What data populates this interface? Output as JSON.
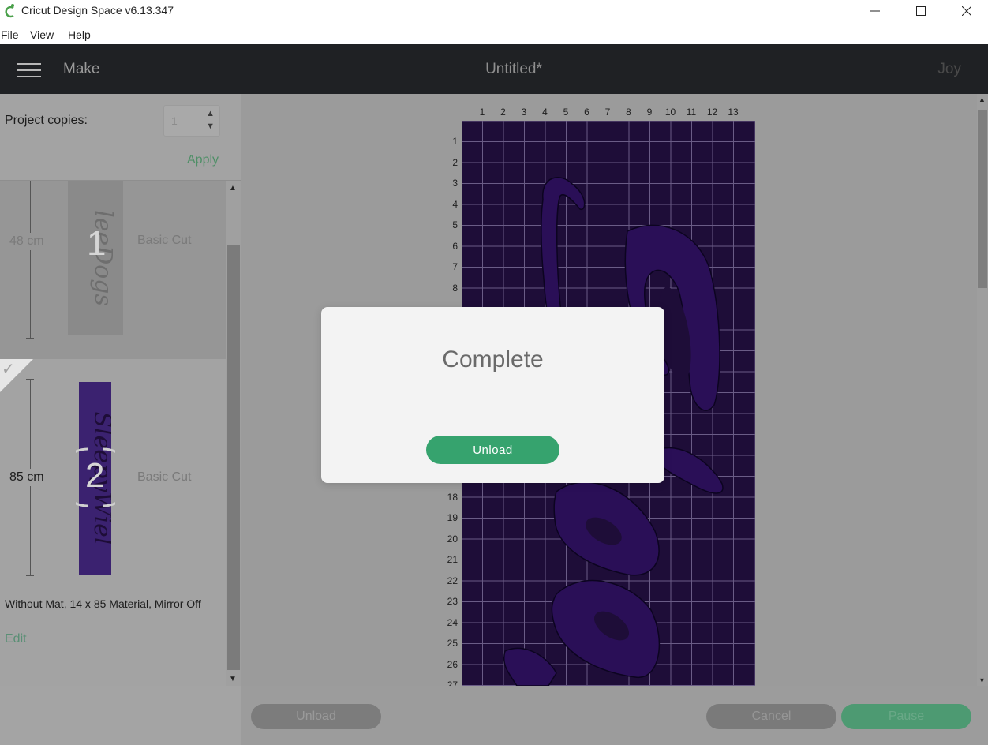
{
  "window": {
    "title": "Cricut Design Space  v6.13.347",
    "minimize": "—",
    "maximize": "☐",
    "close": "✕"
  },
  "menu": {
    "items": [
      "File",
      "View",
      "Help"
    ]
  },
  "header": {
    "section": "Make",
    "document_title": "Untitled*",
    "user": "Joy"
  },
  "copies": {
    "label": "Project copies:",
    "value": "1",
    "apply_label": "Apply"
  },
  "mats": [
    {
      "number": "1",
      "length": "48 cm",
      "type": "Basic Cut",
      "selected": false
    },
    {
      "number": "2",
      "length": "85 cm",
      "type": "Basic Cut",
      "selected": true
    }
  ],
  "mat_settings": {
    "description": "Without Mat, 14 x 85 Material, Mirror Off",
    "edit_label": "Edit"
  },
  "ruler": {
    "columns": [
      "1",
      "2",
      "3",
      "4",
      "5",
      "6",
      "7",
      "8",
      "9",
      "10",
      "11",
      "12",
      "13"
    ],
    "rows": [
      "1",
      "2",
      "3",
      "4",
      "5",
      "6",
      "7",
      "8",
      "",
      "",
      "",
      "",
      "",
      "",
      "",
      "",
      "",
      "18",
      "19",
      "20",
      "21",
      "22",
      "23",
      "24",
      "25",
      "26",
      "27"
    ]
  },
  "footer": {
    "unload_label": "Unload",
    "cancel_label": "Cancel",
    "pause_label": "Pause"
  },
  "modal": {
    "title": "Complete",
    "button_label": "Unload"
  },
  "colors": {
    "accent": "#36a36e",
    "mat": "#1e0d38",
    "design": "#2a0f57",
    "header": "#1f2124"
  },
  "icons": [
    "cricut-logo-icon",
    "hamburger-icon",
    "checkmark-icon",
    "spinner-up-icon",
    "spinner-down-icon"
  ]
}
